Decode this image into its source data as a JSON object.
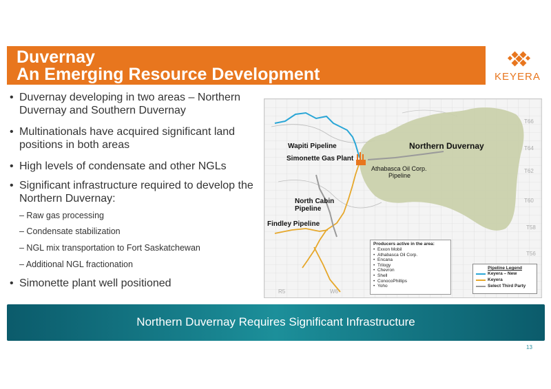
{
  "title": {
    "line1": "Duvernay",
    "line2": "An Emerging Resource Development"
  },
  "logo": {
    "text": "KEYERA",
    "color": "#e8761e"
  },
  "bullets": [
    {
      "text": "Duvernay developing in two areas – Northern Duvernay and Southern Duvernay"
    },
    {
      "text": "Multinationals have acquired significant land positions in both areas"
    },
    {
      "text": "High levels of condensate and other NGLs"
    },
    {
      "text": "Significant infrastructure required to develop the Northern Duvernay:"
    }
  ],
  "sub_bullets": [
    "– Raw gas processing",
    "– Condensate stabilization",
    "– NGL mix transportation to Fort Saskatchewan",
    "– Additional NGL fractionation"
  ],
  "final_bullet": "Simonette plant well positioned",
  "map": {
    "labels": {
      "wapiti": "Wapiti Pipeline",
      "simonette": "Simonette Gas Plant",
      "northern_duvernay": "Northern Duvernay",
      "athabasca_1": "Athabasca Oil Corp.",
      "athabasca_2": "Pipeline",
      "north_cabin_1": "North Cabin",
      "north_cabin_2": "Pipeline",
      "findley": "Findley Pipeline"
    },
    "grid_labels": {
      "t66": "T66",
      "t64": "T64",
      "t62": "T62",
      "t60": "T60",
      "t58": "T58",
      "t56": "T56",
      "r5": "R5",
      "w6": "W6"
    },
    "producers": {
      "header": "Producers active in the area:",
      "items": [
        "Exxon Mobil",
        "Athabasca Oil Corp.",
        "Encana",
        "Trilogy",
        "Chevron",
        "Shell",
        "ConocoPhillips",
        "Yoho"
      ]
    },
    "legend": {
      "header": "Pipeline Legend",
      "items": [
        {
          "label": "Keyera – New",
          "color": "#2aa6d6"
        },
        {
          "label": "Keyera",
          "color": "#e6a72a"
        },
        {
          "label": "Select Third Party",
          "color": "#9a9a9a"
        }
      ]
    },
    "colors": {
      "duvernay_area": "#c9cfa8",
      "grid": "#d4d4d4"
    }
  },
  "banner": {
    "text": "Northern Duvernay Requires Significant Infrastructure"
  },
  "page_number": "13"
}
